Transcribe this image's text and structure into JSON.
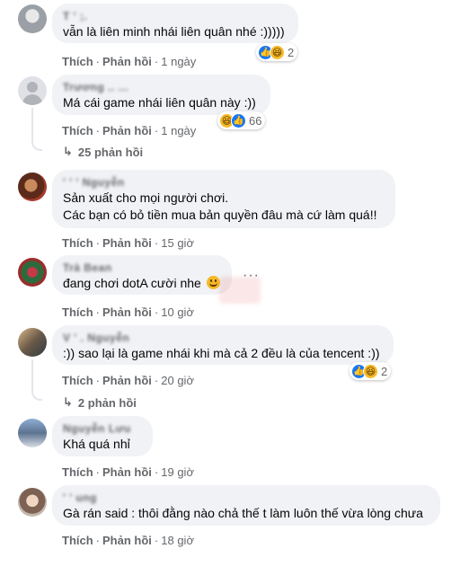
{
  "actions": {
    "like": "Thích",
    "reply": "Phản hồi",
    "separator": "·"
  },
  "comments": [
    {
      "author": "T   '   ;.",
      "text": "vẫn là liên minh nhái liên quân nhé :)))))",
      "time": "1 ngày",
      "reactions": {
        "icons": [
          "like-icon",
          "haha-icon"
        ],
        "count": "2"
      }
    },
    {
      "author": "Trương   .. ...",
      "text": "Má cái game nhái liên quân này :))",
      "time": "1 ngày",
      "reactions": {
        "icons": [
          "haha-icon",
          "like-icon"
        ],
        "count": "66"
      },
      "replies": "25 phản hồi"
    },
    {
      "author": "'   '   '  Nguyễn",
      "text_lines": [
        "Sản xuất cho mọi người chơi.",
        "Các bạn có bỏ tiền mua bản quyền đâu mà cứ làm quá!!"
      ],
      "time": "15 giờ"
    },
    {
      "author": "Trà Bean",
      "text": "đang chơi dotA cười nhe",
      "emoji": "smiley-emoji",
      "time": "10 giờ"
    },
    {
      "author": "V   '   .  Nguyễn",
      "text": ":)) sao lại là game nhái khi mà cả 2 đều là của tencent :))",
      "time": "20 giờ",
      "reactions": {
        "icons": [
          "like-icon",
          "haha-icon"
        ],
        "count": "2"
      },
      "replies": "2 phản hồi"
    },
    {
      "author": "Nguyễn   Lưu",
      "text": "Khá quá nhỉ",
      "time": "19 giờ"
    },
    {
      "author": "'   '  ung",
      "text": "Gà rán said : thôi đằng nào chả thế t làm luôn thế vừa lòng chưa",
      "time": "18 giờ"
    }
  ],
  "colors": {
    "bubble": "#f0f2f5",
    "meta": "#65676b",
    "like": "#1877f2",
    "haha": "#f7b928"
  }
}
